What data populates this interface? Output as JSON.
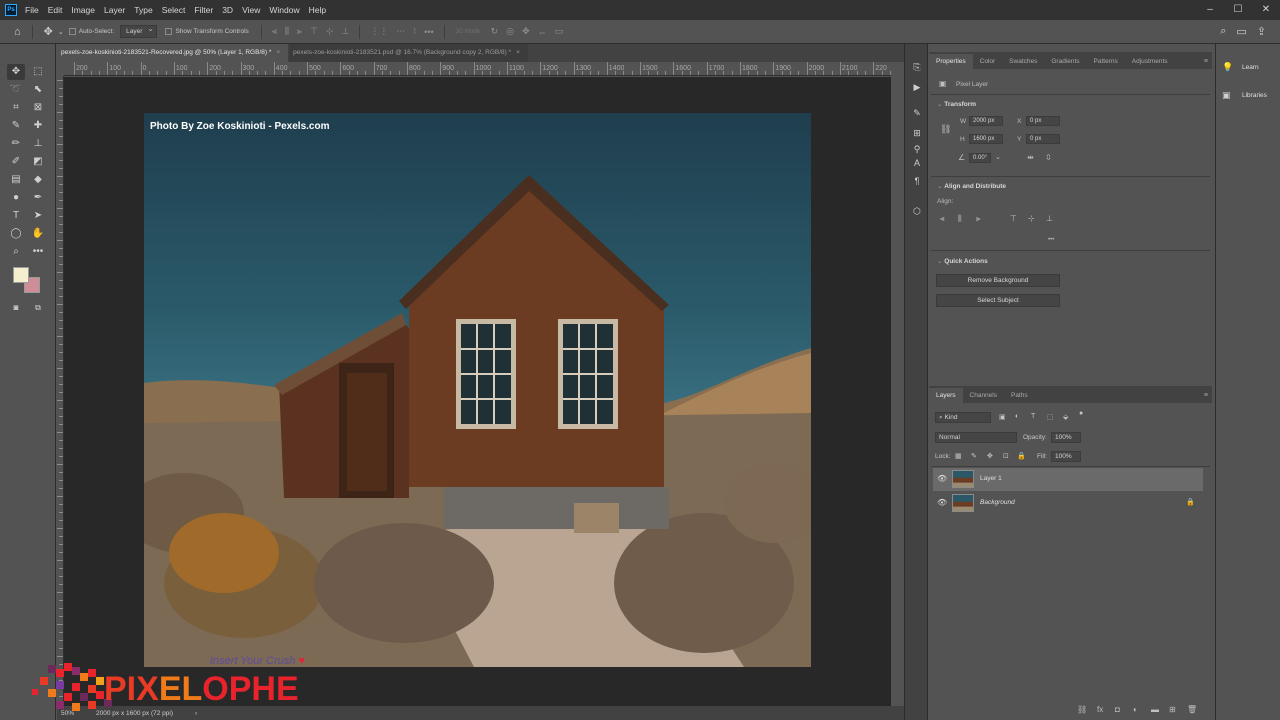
{
  "menubar": {
    "items": [
      "File",
      "Edit",
      "Image",
      "Layer",
      "Type",
      "Select",
      "Filter",
      "3D",
      "View",
      "Window",
      "Help"
    ],
    "controls": [
      "–",
      "☐",
      "✕"
    ]
  },
  "options": {
    "auto_select": "Auto-Select:",
    "layer_select": "Layer",
    "show_transform": "Show Transform Controls",
    "mode3d": "3D Mode:"
  },
  "tabs": [
    {
      "label": "pexels-zoe-koskinioti-2183521-Recovered.jpg @ 50% (Layer 1, RGB/8) *",
      "close": "×"
    },
    {
      "label": "pexels-zoe-koskinioti-2183521.psd @ 16.7% (Background copy 2, RGB/8) *",
      "close": "×"
    }
  ],
  "ruler": {
    "labels": [
      "200",
      "100",
      "0",
      "100",
      "200",
      "300",
      "400",
      "500",
      "600",
      "700",
      "800",
      "900",
      "1000",
      "1100",
      "1200",
      "1300",
      "1400",
      "1500",
      "1600",
      "1700",
      "1800",
      "1900",
      "2000",
      "2100",
      "220"
    ]
  },
  "canvas": {
    "credit": "Photo By Zoe Koskinioti - Pexels.com"
  },
  "status": {
    "zoom": "50%",
    "doc_size": "2000 px x 1600 px (72 ppi)"
  },
  "watermark": {
    "tag": "Insert Your Crush",
    "heart": "♥",
    "brand_a": "PIX",
    "brand_b": "EL",
    "brand_c": "OPHE",
    "colors": {
      "red": "#e83a25",
      "orange": "#f07b1b"
    }
  },
  "properties": {
    "tabs": [
      "Properties",
      "Color",
      "Swatches",
      "Gradients",
      "Patterns",
      "Adjustments"
    ],
    "kind": "Pixel Layer",
    "transform_title": "Transform",
    "w_label": "W",
    "w_value": "2000 px",
    "h_label": "H",
    "h_value": "1600 px",
    "x_label": "X",
    "x_value": "0 px",
    "y_label": "Y",
    "y_value": "0 px",
    "angle": "0.00°",
    "align_title": "Align and Distribute",
    "align_label": "Align:",
    "more": "•••",
    "quick_title": "Quick Actions",
    "btn_remove_bg": "Remove Background",
    "btn_select_subject": "Select Subject"
  },
  "layers": {
    "tabs": [
      "Layers",
      "Channels",
      "Paths"
    ],
    "kind_label": "Kind",
    "blend_mode": "Normal",
    "opacity_label": "Opacity:",
    "opacity_value": "100%",
    "lock_label": "Lock:",
    "fill_label": "Fill:",
    "fill_value": "100%",
    "items": [
      {
        "name": "Layer 1"
      },
      {
        "name": "Background"
      }
    ]
  },
  "learn_panel": {
    "items": [
      "Learn",
      "Libraries"
    ]
  },
  "ui_colors": {
    "panel_bg": "#535353",
    "dark_bg": "#323232",
    "canvas_bg": "#282828",
    "foreground_swatch": "#f4efce",
    "background_swatch": "#cf8d98"
  }
}
